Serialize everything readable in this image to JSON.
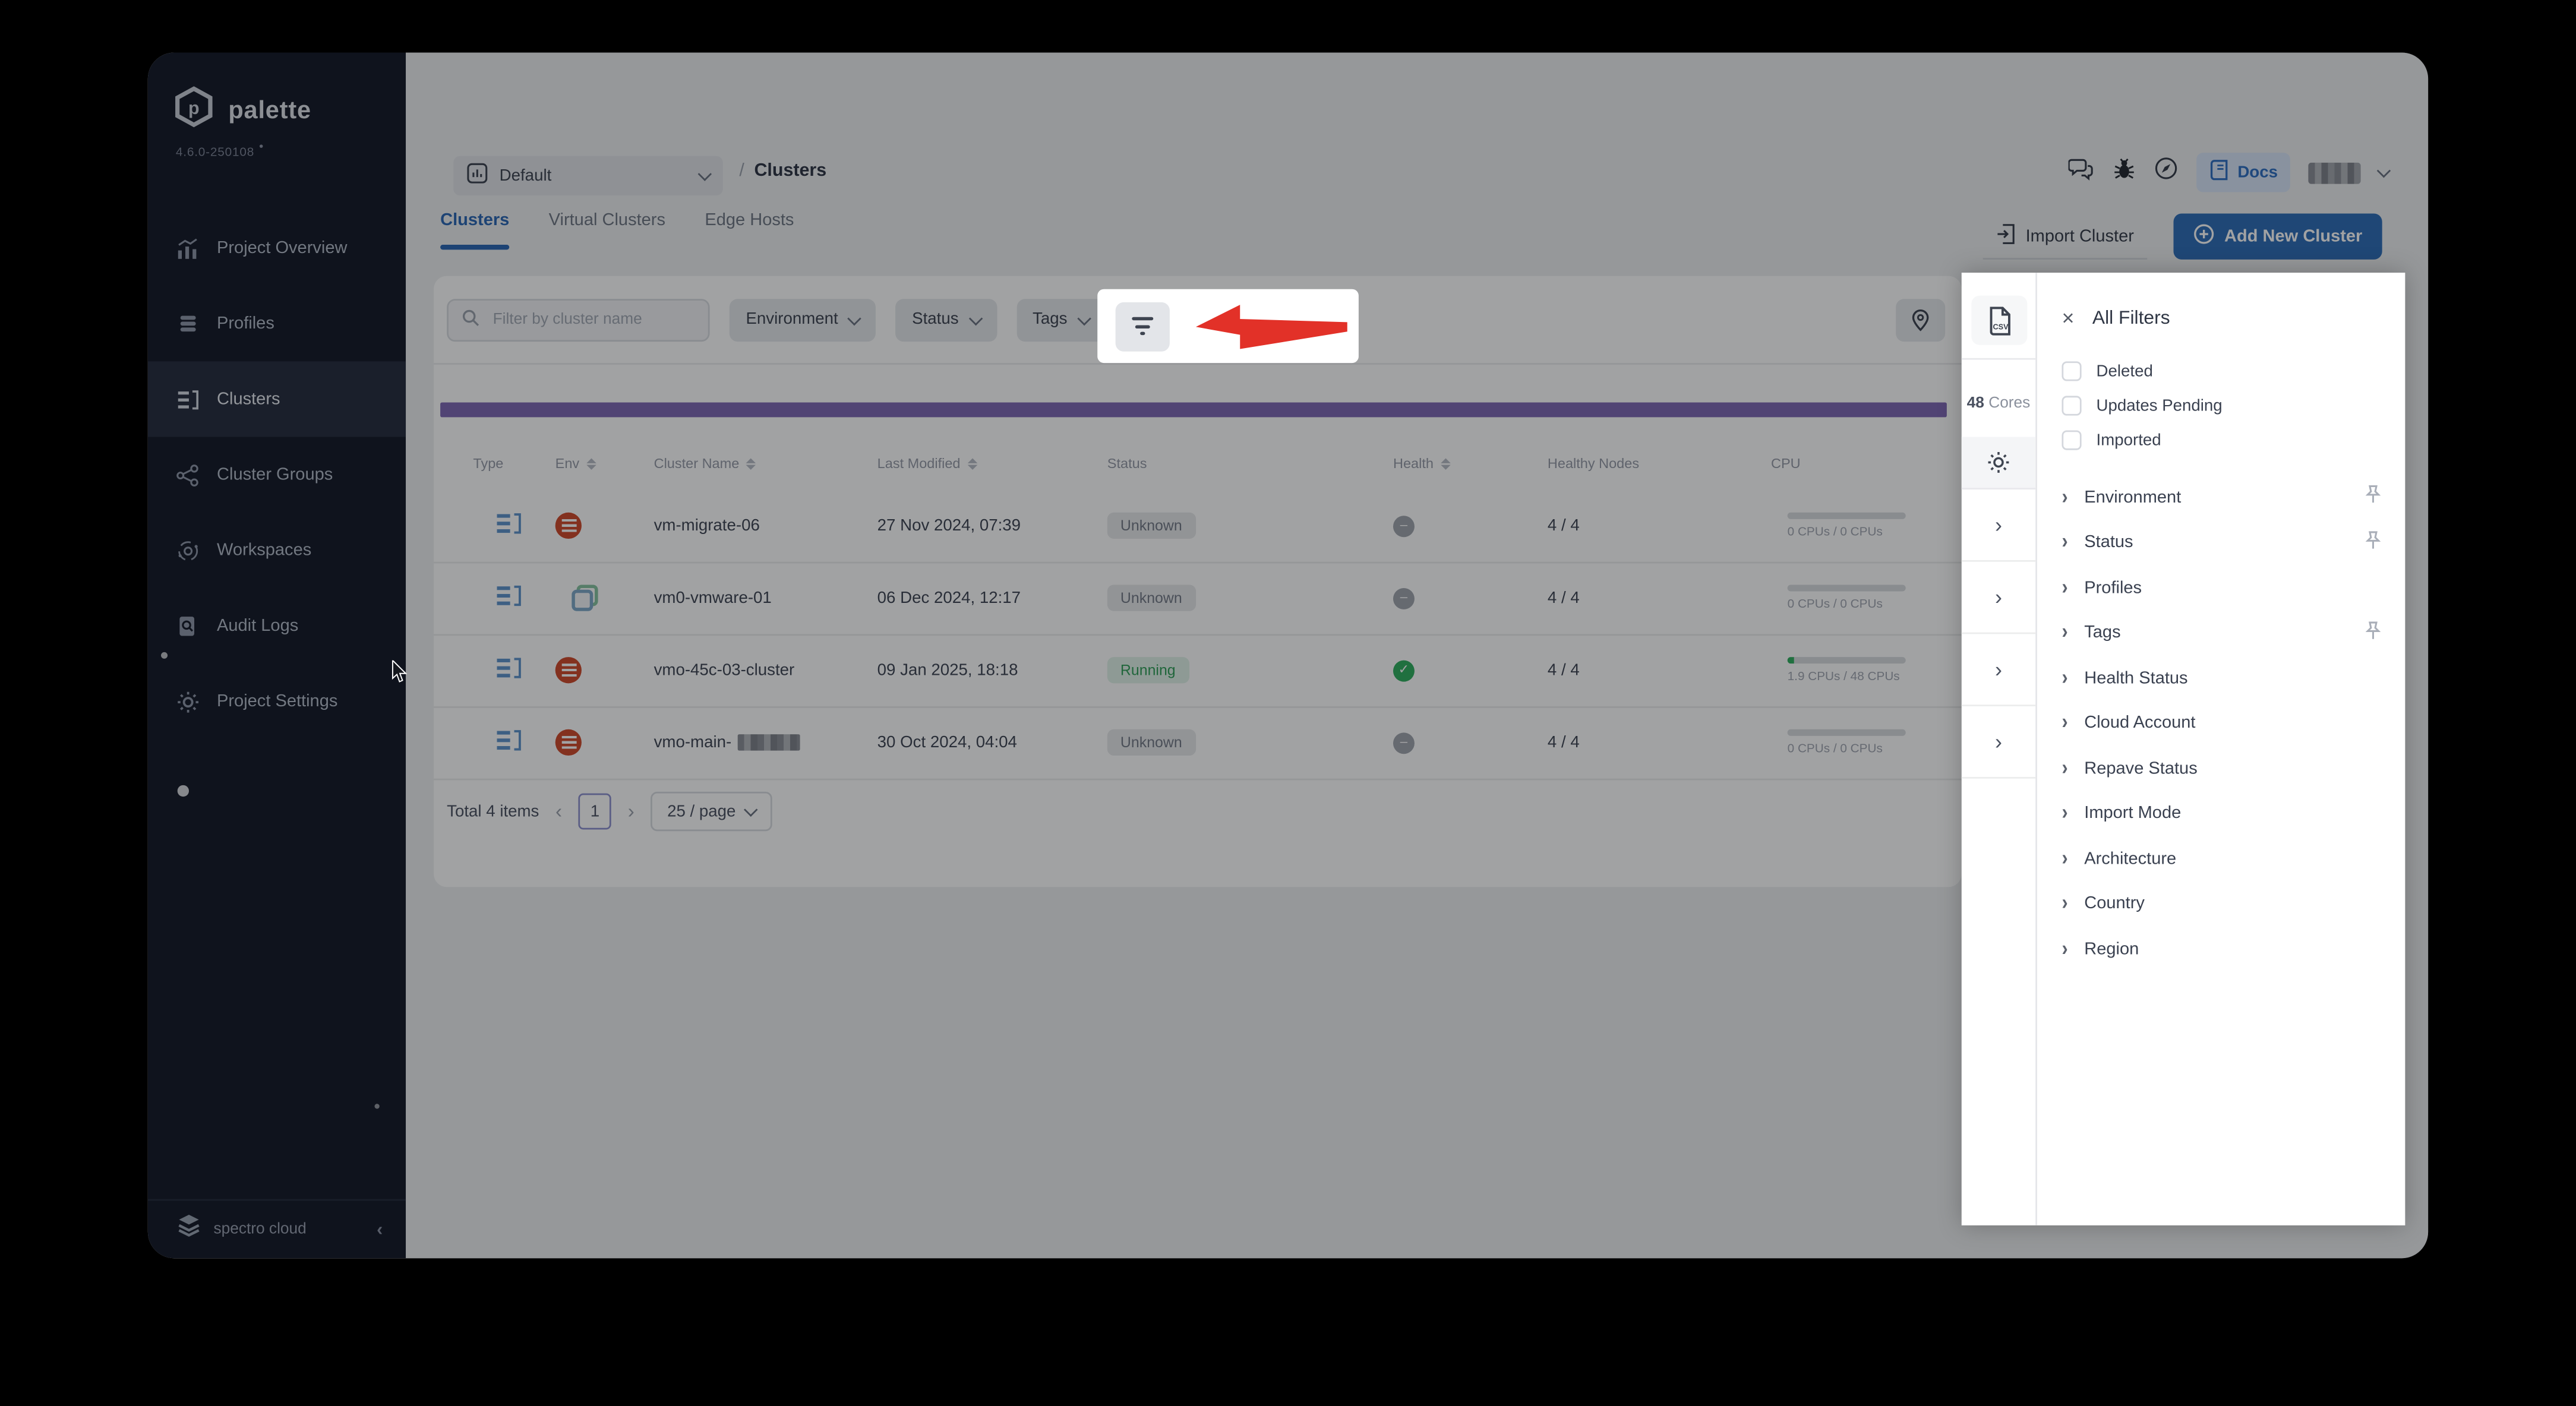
{
  "sidebar": {
    "brand": "palette",
    "version": "4.6.0-250108",
    "items": [
      {
        "label": "Project Overview",
        "icon": "bar-chart-icon"
      },
      {
        "label": "Profiles",
        "icon": "layers-icon"
      },
      {
        "label": "Clusters",
        "icon": "cluster-list-icon",
        "active": true
      },
      {
        "label": "Cluster Groups",
        "icon": "network-icon"
      },
      {
        "label": "Workspaces",
        "icon": "orbit-icon"
      },
      {
        "label": "Audit Logs",
        "icon": "audit-doc-icon"
      },
      {
        "label": "Project Settings",
        "icon": "gear-icon"
      }
    ],
    "footer_brand": "spectro cloud"
  },
  "topbar": {
    "project_selector": "Default",
    "breadcrumb_separator": "/",
    "breadcrumb_current": "Clusters",
    "docs_label": "Docs",
    "icons": [
      "chat-icon",
      "bug-icon",
      "compass-icon"
    ]
  },
  "tabs": [
    {
      "label": "Clusters",
      "active": true
    },
    {
      "label": "Virtual Clusters",
      "active": false
    },
    {
      "label": "Edge Hosts",
      "active": false
    }
  ],
  "actions": {
    "import_label": "Import Cluster",
    "add_label": "Add New Cluster"
  },
  "toolbar": {
    "search_placeholder": "Filter by cluster name",
    "dropdowns": [
      "Environment",
      "Status",
      "Tags"
    ]
  },
  "usage": {
    "cores_value": "48",
    "cores_unit": "Cores"
  },
  "table": {
    "columns": [
      "Type",
      "Env",
      "Cluster Name",
      "Last Modified",
      "Status",
      "Health",
      "Healthy Nodes",
      "CPU"
    ],
    "rows": [
      {
        "name": "vm-migrate-06",
        "last_modified": "27 Nov 2024, 07:39",
        "status": "Unknown",
        "healthy_nodes": "4 / 4",
        "cpu": "0 CPUs / 0 CPUs"
      },
      {
        "name": "vm0-vmware-01",
        "last_modified": "06 Dec 2024, 12:17",
        "status": "Unknown",
        "healthy_nodes": "4 / 4",
        "cpu": "0 CPUs / 0 CPUs"
      },
      {
        "name": "vmo-45c-03-cluster",
        "last_modified": "09 Jan 2025, 18:18",
        "status": "Running",
        "healthy_nodes": "4 / 4",
        "cpu": "1.9 CPUs / 48 CPUs"
      },
      {
        "name": "vmo-main-",
        "last_modified": "30 Oct 2024, 04:04",
        "status": "Unknown",
        "healthy_nodes": "4 / 4",
        "cpu": "0 CPUs / 0 CPUs"
      }
    ]
  },
  "pagination": {
    "total_label": "Total 4 items",
    "prev": "‹",
    "next": "›",
    "current_page": "1",
    "page_size": "25 / page"
  },
  "filter_panel": {
    "title": "All Filters",
    "close_glyph": "×",
    "csv_label": "csv",
    "checkboxes": [
      {
        "label": "Deleted"
      },
      {
        "label": "Updates Pending"
      },
      {
        "label": "Imported"
      }
    ],
    "sections": [
      {
        "label": "Environment",
        "pinned": true
      },
      {
        "label": "Status",
        "pinned": true
      },
      {
        "label": "Profiles",
        "pinned": false
      },
      {
        "label": "Tags",
        "pinned": true
      },
      {
        "label": "Health Status",
        "pinned": false
      },
      {
        "label": "Cloud Account",
        "pinned": false
      },
      {
        "label": "Repave Status",
        "pinned": false
      },
      {
        "label": "Import Mode",
        "pinned": false
      },
      {
        "label": "Architecture",
        "pinned": false
      },
      {
        "label": "Country",
        "pinned": false
      },
      {
        "label": "Region",
        "pinned": false
      }
    ]
  },
  "colors": {
    "accent_blue": "#2f72c4",
    "status_green": "#2fae5e",
    "env_red": "#cf4a2b",
    "cores_purple": "#7e68b4",
    "arrow_red": "#e23128",
    "sidebar_bg": "#141927"
  }
}
